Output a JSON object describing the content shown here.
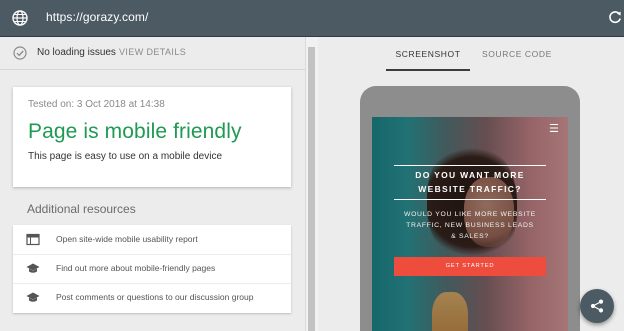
{
  "browser": {
    "url": "https://gorazy.com/"
  },
  "status": {
    "text": "No loading issues",
    "details_link": "VIEW DETAILS"
  },
  "result": {
    "tested_on": "Tested on: 3 Oct 2018 at 14:38",
    "verdict": "Page is mobile friendly",
    "verdict_color": "#1e9a52",
    "description": "This page is easy to use on a mobile device"
  },
  "resources": {
    "heading": "Additional resources",
    "items": [
      {
        "icon": "browser-window-icon",
        "label": "Open site-wide mobile usability report"
      },
      {
        "icon": "graduation-cap-icon",
        "label": "Find out more about mobile-friendly pages"
      },
      {
        "icon": "graduation-cap-icon",
        "label": "Post comments or questions to our discussion group"
      }
    ]
  },
  "tabs": {
    "items": [
      {
        "label": "SCREENSHOT",
        "active": true
      },
      {
        "label": "SOURCE CODE",
        "active": false
      }
    ]
  },
  "preview": {
    "headline_line1": "DO YOU WANT MORE",
    "headline_line2": "WEBSITE TRAFFIC?",
    "sub_line1": "WOULD YOU LIKE MORE WEBSITE",
    "sub_line2": "TRAFFIC, NEW BUSINESS LEADS",
    "sub_line3": "& SALES?",
    "cta": "GET STARTED",
    "menu_icon": "hamburger-menu-icon",
    "cta_color": "#ee4c3d"
  },
  "colors": {
    "topbar": "#4c5a63",
    "accent_green": "#1e9a52"
  }
}
